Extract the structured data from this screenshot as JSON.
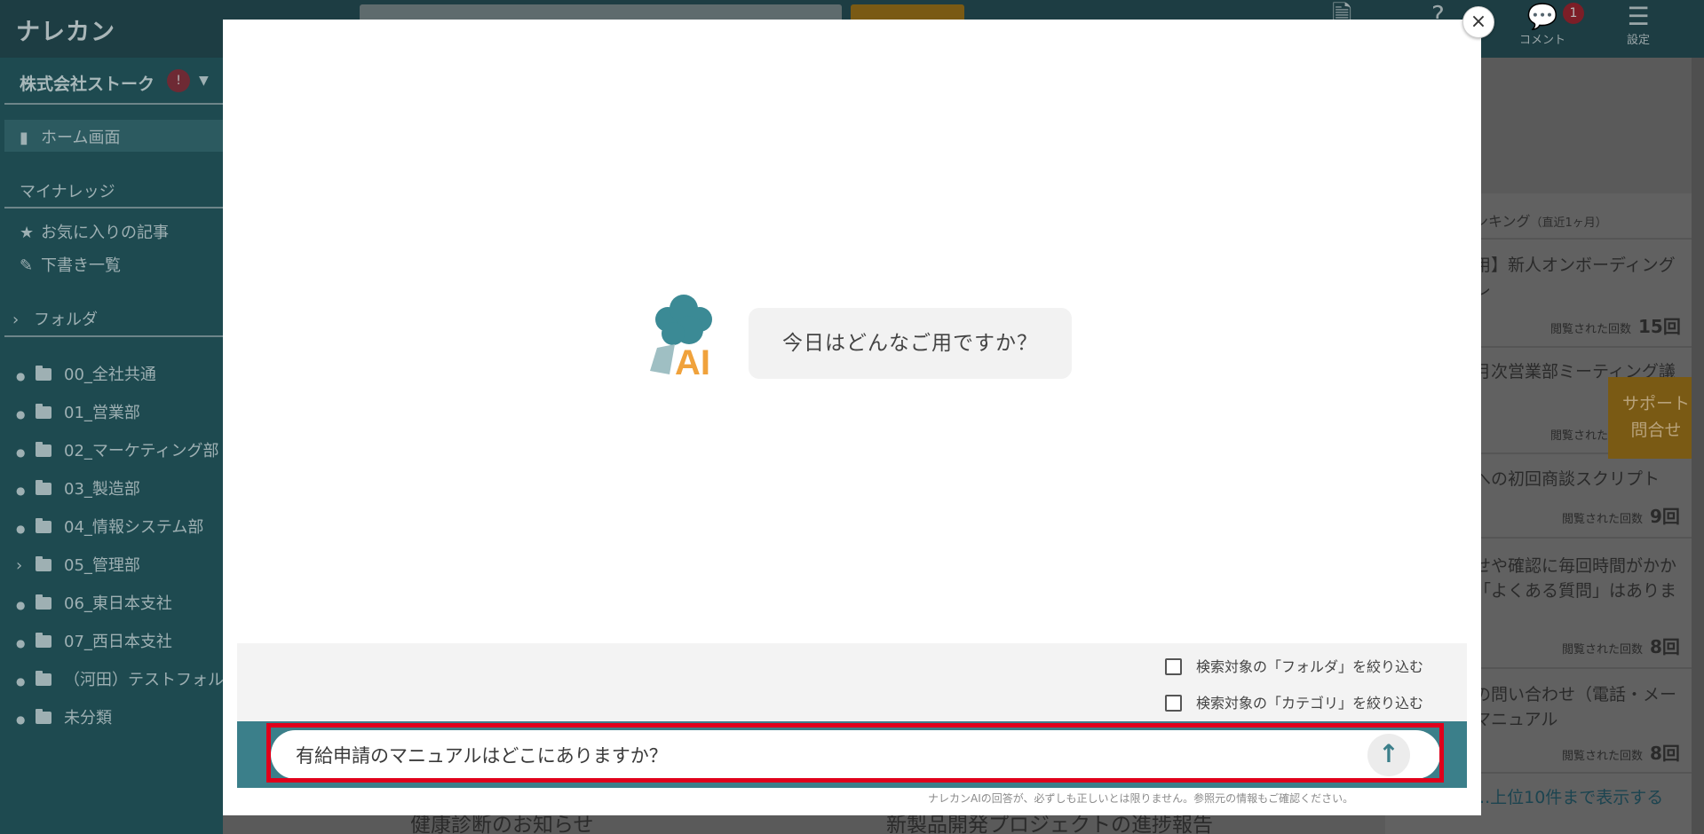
{
  "app": {
    "logo": "ナレカン"
  },
  "topbar": {
    "comment_label": "コメント",
    "comment_badge": "1",
    "settings_label": "設定"
  },
  "sidebar": {
    "company": "株式会社ストーク",
    "company_badge": "!",
    "home": "ホーム画面",
    "my_knowledge": "マイナレッジ",
    "favorites": "お気に入りの記事",
    "drafts": "下書き一覧",
    "folder_section": "フォルダ",
    "folders": [
      "00_全社共通",
      "01_営業部",
      "02_マーケティング部",
      "03_製造部",
      "04_情報システム部",
      "05_管理部",
      "06_東日本支社",
      "07_西日本支社",
      "（河田）テストフォル",
      "未分類"
    ]
  },
  "ranking": {
    "header": "ンキング",
    "header_sub": "（直近1ヶ月）",
    "items": [
      {
        "title_line1": "用】新人オンボーディング",
        "title_line2": "レ",
        "views_label": "閲覧された回数",
        "views": "15回"
      },
      {
        "title_line1": "月次営業部ミーティング議",
        "title_line2": "",
        "views_label": "閲覧された回数",
        "views": ""
      },
      {
        "title_line1": "への初回商談スクリプト",
        "title_line2": "",
        "views_label": "閲覧された回数",
        "views": "9回"
      },
      {
        "title_line1": "せや確認に毎回時間がかか",
        "title_line2": "「よくある質問」はありま",
        "views_label": "閲覧された回数",
        "views": "8回"
      },
      {
        "title_line1": "の問い合わせ（電話・メー",
        "title_line2": "マニュアル",
        "views_label": "閲覧された回数",
        "views": "8回"
      }
    ],
    "more_link": "...上位10件まで表示する"
  },
  "support": {
    "line1": "サポート",
    "line2": "問合せ"
  },
  "bottom_cards": [
    "健康診断のお知らせ",
    "新製品開発プロジェクトの進捗報告"
  ],
  "modal": {
    "close": "×",
    "ai_logo_text": "AI",
    "greeting": "今日はどんなご用ですか？",
    "filter_folder": "検索対象の「フォルダ」を絞り込む",
    "filter_category": "検索対象の「カテゴリ」を絞り込む",
    "input_value": "有給申請のマニュアルはどこにありますか？",
    "send_icon": "↑",
    "disclaimer": "ナレカンAIの回答が、必ずしも正しいとは限りません。参照元の情報もご確認ください。"
  },
  "colors": {
    "teal": "#3b7f8a",
    "highlight": "#e0001b",
    "ai_orange": "#f0a23c"
  }
}
